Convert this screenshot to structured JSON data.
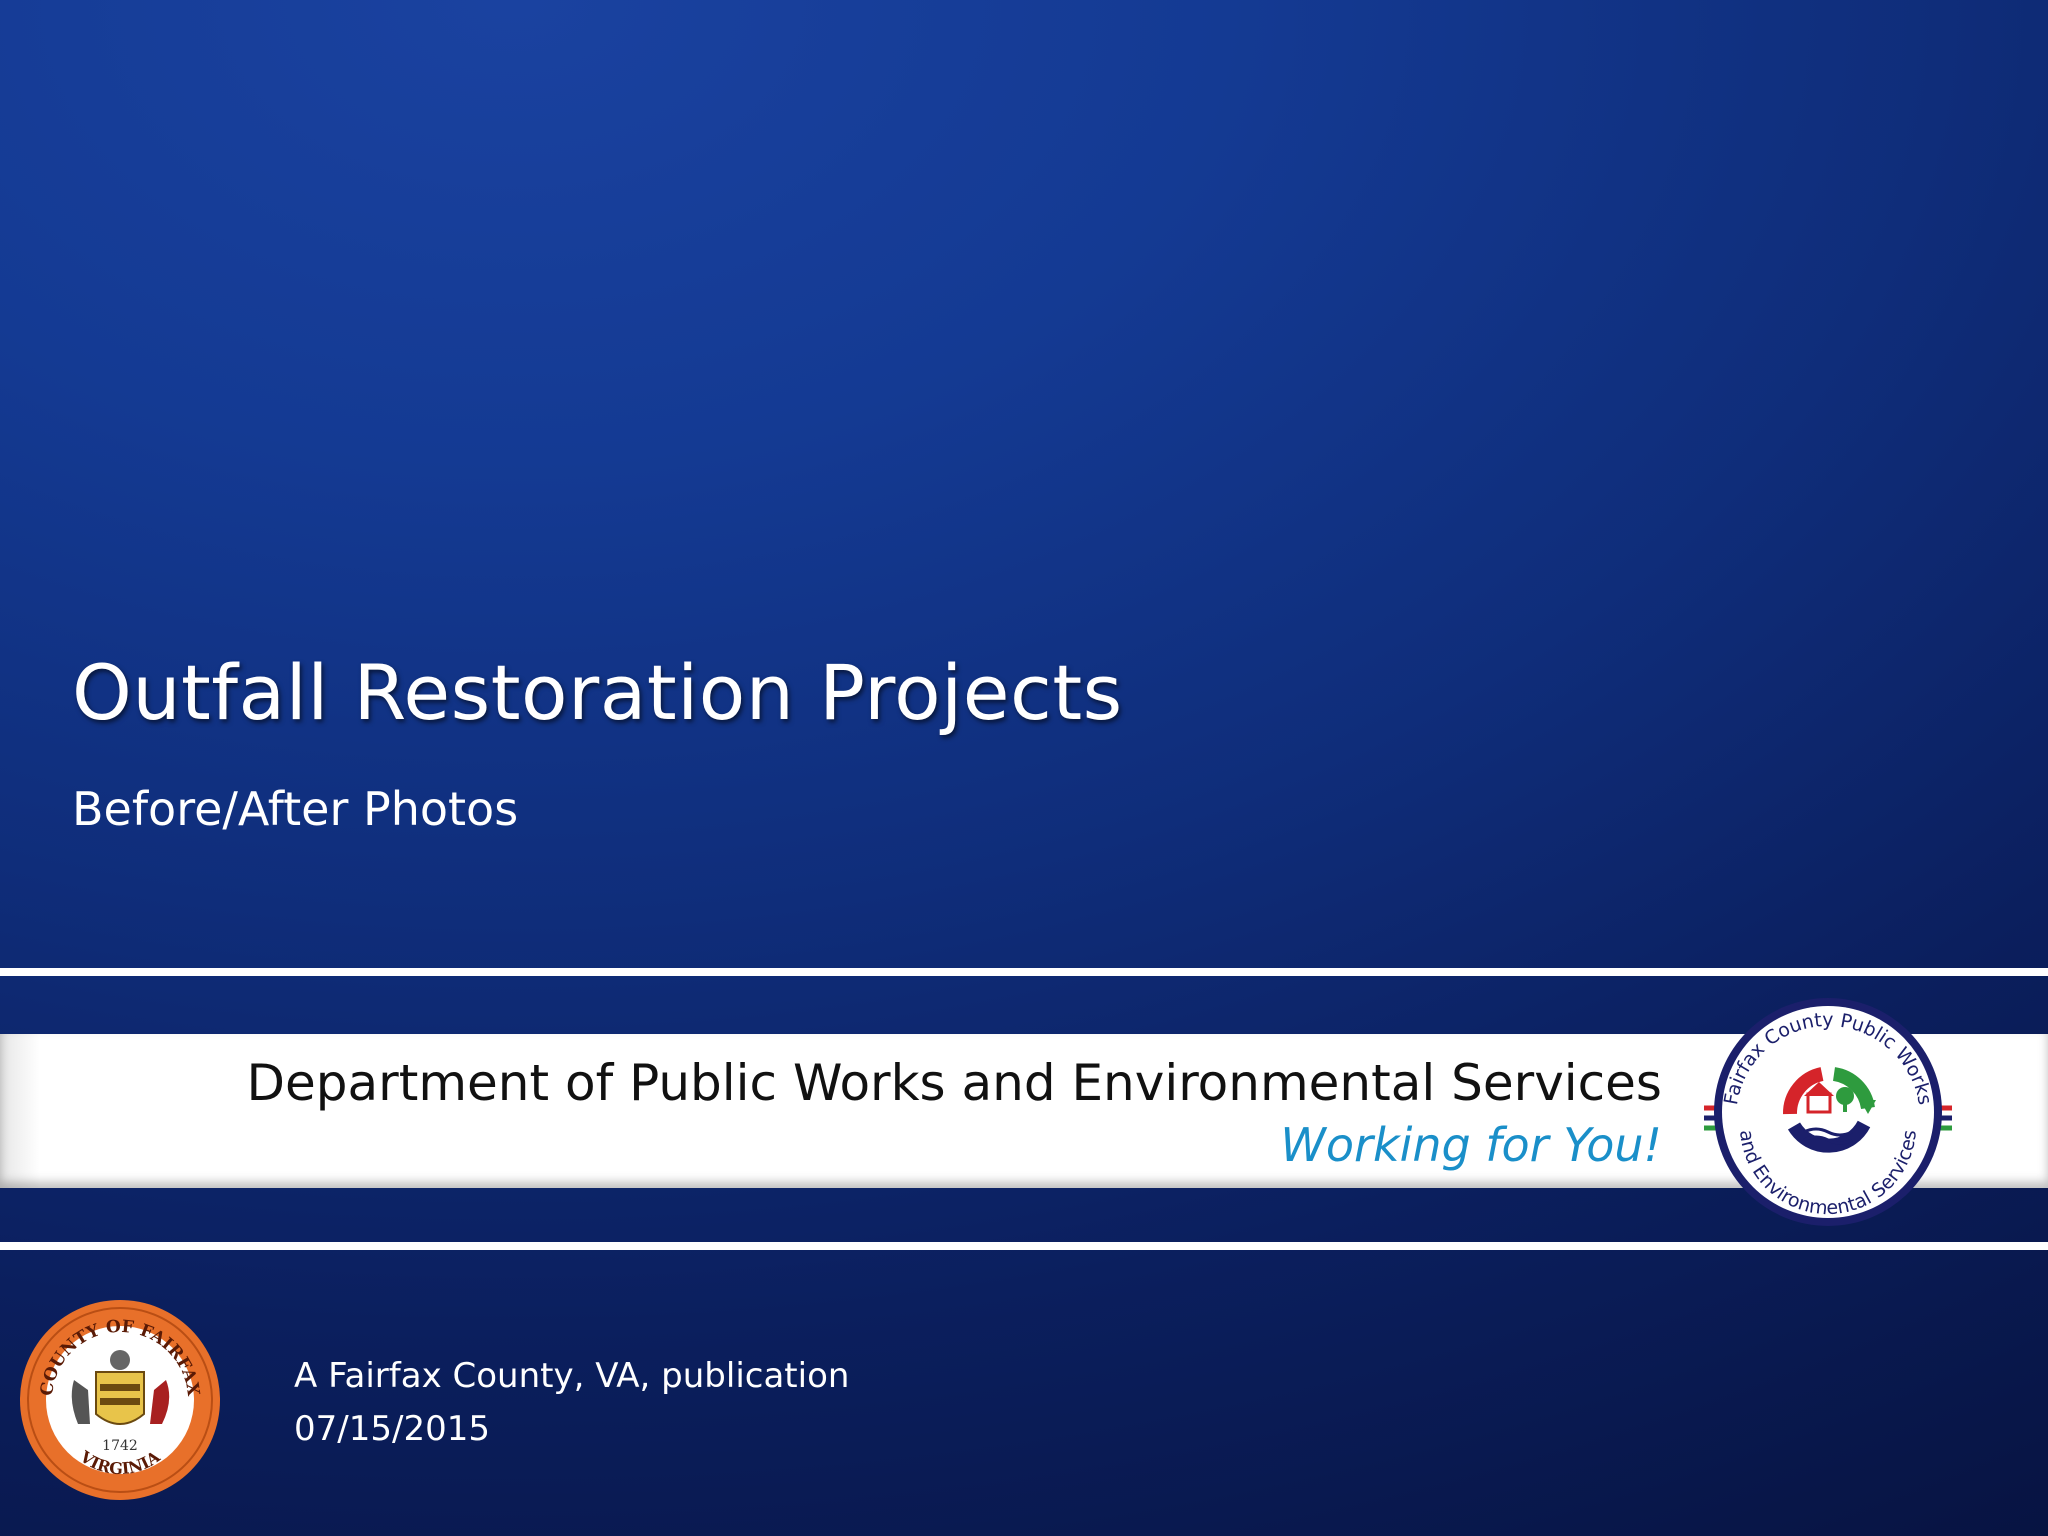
{
  "slide": {
    "title": "Outfall Restoration Projects",
    "subtitle": "Before/After Photos"
  },
  "banner": {
    "department": "Department of Public Works and Environmental Services",
    "tagline": "Working for You!",
    "logo_icon": "dpwes-logo-icon",
    "logo_text": "Fairfax County Public Works and Environmental Services"
  },
  "footer": {
    "publication": "A Fairfax County, VA, publication",
    "date": "07/15/2015",
    "seal_icon": "county-seal-icon",
    "seal_text_top": "COUNTY OF FAIRFAX",
    "seal_year": "1742",
    "seal_text_bottom": "VIRGINIA"
  },
  "colors": {
    "background": "#143a93",
    "tagline": "#1a8fc9",
    "logo_red": "#d5242a",
    "logo_green": "#2e9b3e",
    "logo_navy": "#1b1f6b",
    "seal_orange": "#e8702a"
  }
}
